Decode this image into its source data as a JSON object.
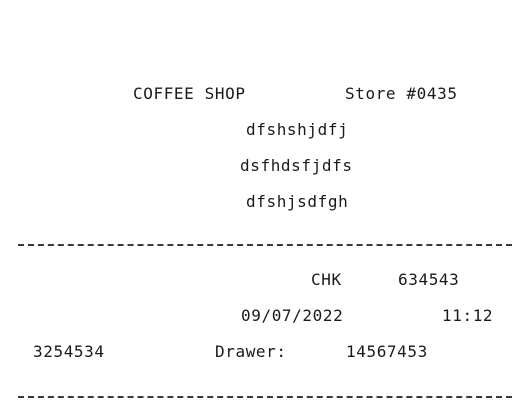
{
  "receipt": {
    "header": {
      "shop_name": "COFFEE SHOP",
      "store": "Store #0435"
    },
    "address_lines": [
      "dfshshjdfj",
      "dsfhdsfjdfs",
      "dfshjsdfgh"
    ],
    "check_label": "CHK",
    "check_number": "634543",
    "date": "09/07/2022",
    "time": "11:12",
    "terminal_id": "3254534",
    "drawer_label": "Drawer:",
    "drawer_number": "14567453"
  }
}
